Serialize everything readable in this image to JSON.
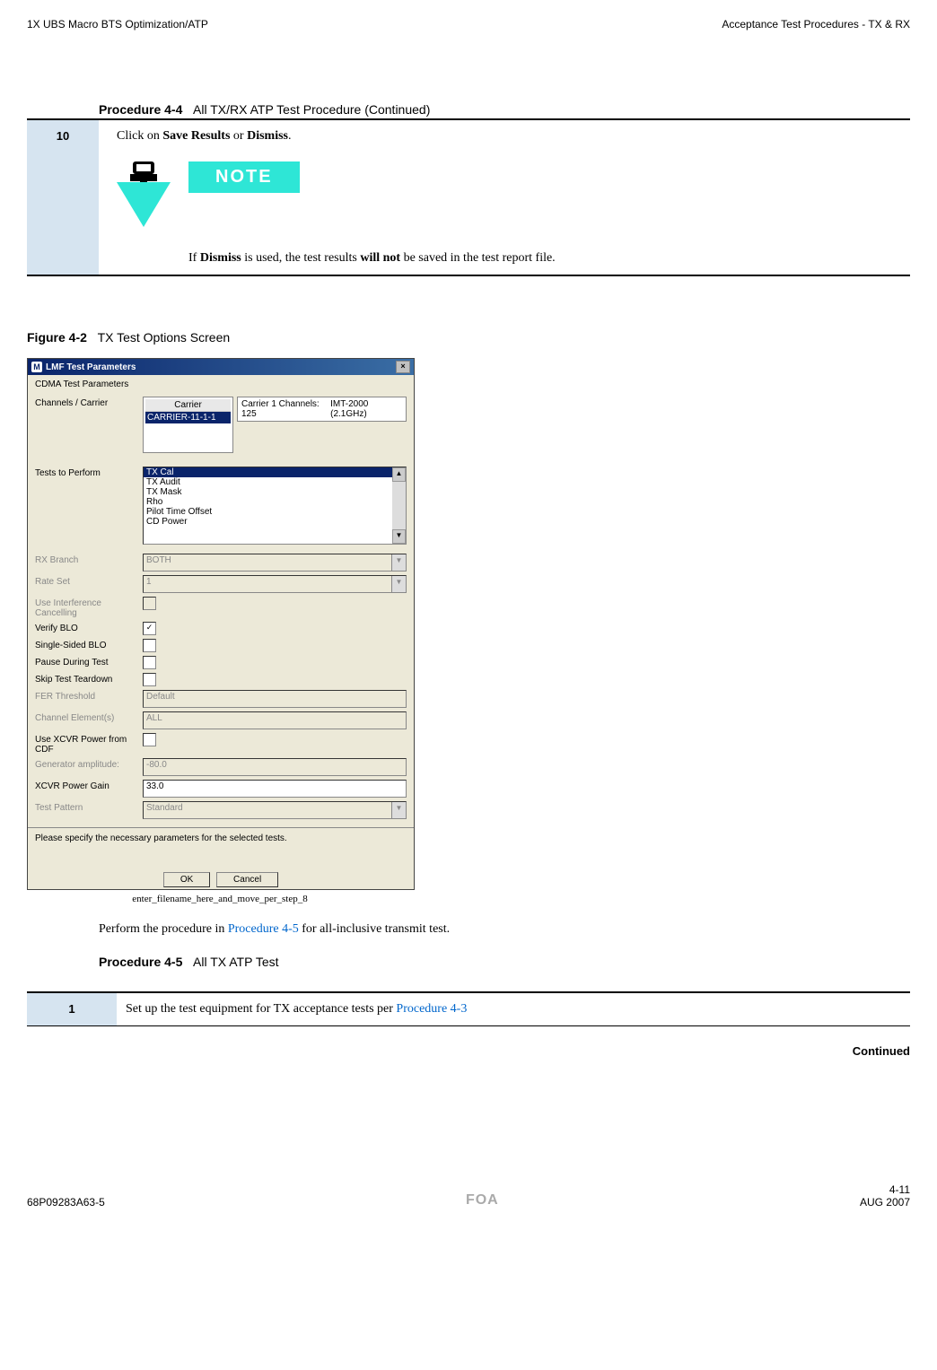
{
  "header": {
    "left": "1X UBS Macro BTS Optimization/ATP",
    "right": "Acceptance Test Procedures - TX & RX"
  },
  "procedure44": {
    "label": "Procedure 4-4",
    "title": "All TX/RX ATP Test Procedure (Continued)",
    "step_number": "10",
    "step_text_prefix": "Click on ",
    "save_results": "Save Results",
    "or_text": " or ",
    "dismiss": "Dismiss",
    "period": ".",
    "note_badge": "NOTE",
    "note_if": "If ",
    "note_dismiss": "Dismiss",
    "note_mid": " is used, the test results ",
    "note_willnot": "will not",
    "note_end": " be saved in the test report file."
  },
  "figure": {
    "label": "Figure 4-2",
    "title": "TX Test Options Screen",
    "caption": "enter_filename_here_and_move_per_step_8"
  },
  "lmf": {
    "window_title": "LMF Test Parameters",
    "groupbox": "CDMA Test Parameters",
    "channels_carrier": "Channels / Carrier",
    "carrier_header": "Carrier",
    "carrier_selected": "CARRIER-11-1-1",
    "channel_label": "Carrier 1 Channels:",
    "channel_value": "125",
    "channel_band": "IMT-2000 (2.1GHz)",
    "tests_to_perform": "Tests to Perform",
    "tests": [
      "TX Cal",
      "TX Audit",
      "TX Mask",
      "Rho",
      "Pilot Time Offset",
      "CD Power"
    ],
    "rx_branch": "RX Branch",
    "rx_branch_val": "BOTH",
    "rate_set": "Rate Set",
    "rate_set_val": "1",
    "use_interference": "Use Interference Cancelling",
    "verify_blo": "Verify BLO",
    "single_sided_blo": "Single-Sided BLO",
    "pause_during_test": "Pause During Test",
    "skip_test_teardown": "Skip Test Teardown",
    "fer_threshold": "FER Threshold",
    "fer_threshold_val": "Default",
    "channel_elements": "Channel Element(s)",
    "channel_elements_val": "ALL",
    "use_xcvr_cdf": "Use XCVR Power from CDF",
    "generator_amplitude": "Generator amplitude:",
    "generator_amplitude_val": "-80.0",
    "xcvr_power_gain": "XCVR Power Gain",
    "xcvr_power_gain_val": "33.0",
    "test_pattern": "Test Pattern",
    "test_pattern_val": "Standard",
    "status_text": "Please specify the necessary parameters for the selected tests.",
    "ok": "OK",
    "cancel": "Cancel"
  },
  "body": {
    "perform_prefix": "Perform the procedure in ",
    "procedure45_link": "Procedure 4-5",
    "perform_suffix": " for all-inclusive transmit test."
  },
  "procedure45": {
    "label": "Procedure 4-5",
    "title": "All TX ATP Test",
    "step_number": "1",
    "step_text_prefix": "Set up the test equipment for TX acceptance tests per ",
    "procedure43_link": "Procedure 4-3",
    "continued": "Continued"
  },
  "footer": {
    "doc_number": "68P09283A63-5",
    "foa": "FOA",
    "page": "4-11",
    "date": "AUG 2007"
  }
}
